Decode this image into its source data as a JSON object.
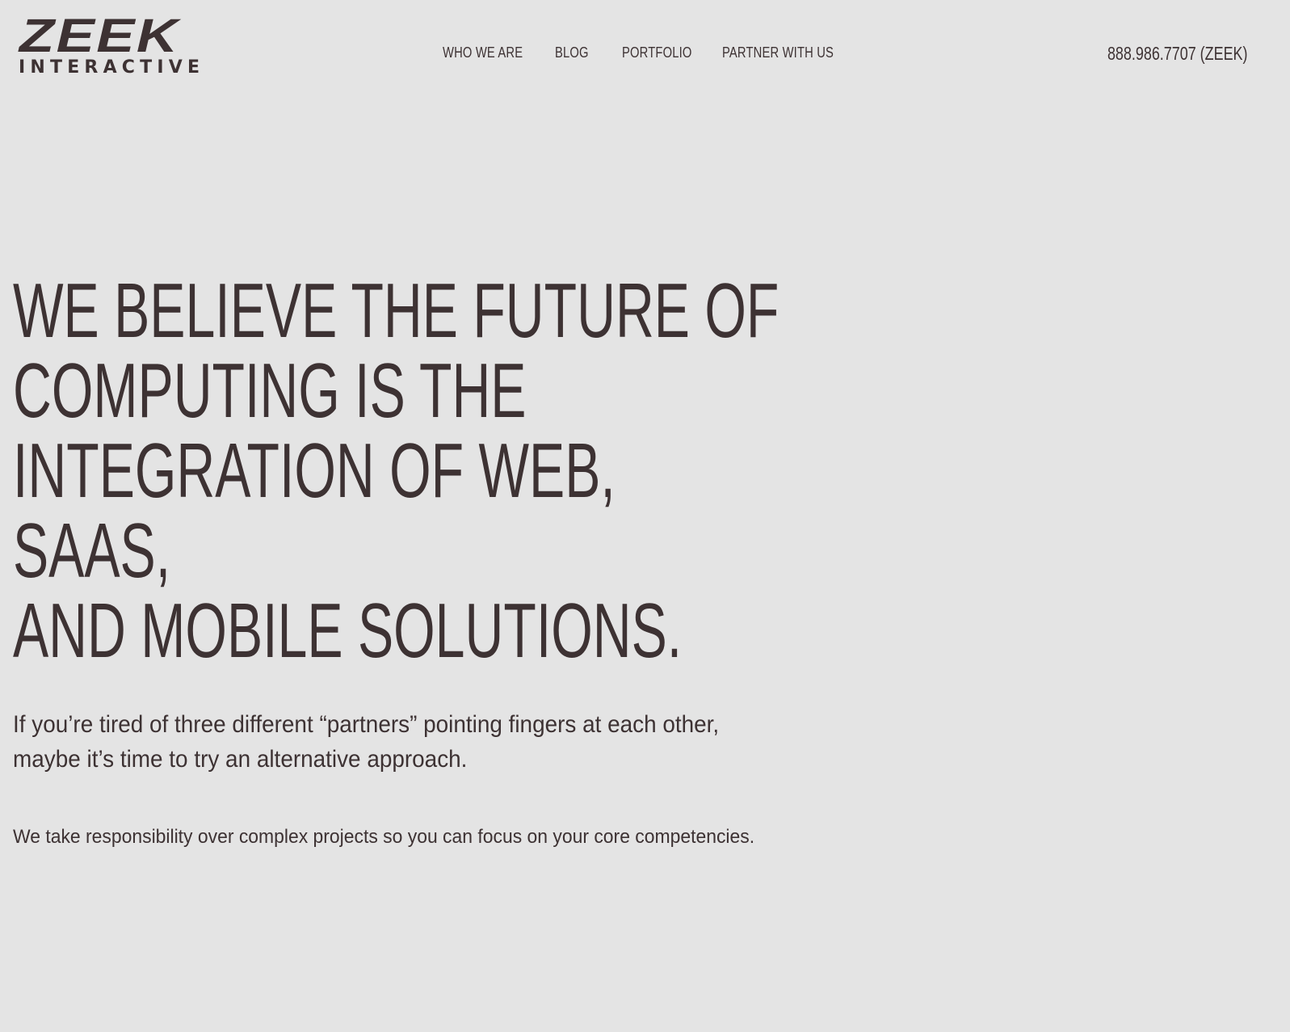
{
  "header": {
    "logo": {
      "word": "ZEEK",
      "sub": "INTERACTIVE"
    },
    "nav": [
      {
        "label": "WHO WE ARE"
      },
      {
        "label": "BLOG"
      },
      {
        "label": "PORTFOLIO"
      },
      {
        "label": "PARTNER WITH US"
      }
    ],
    "phone": "888.986.7707 (ZEEK)"
  },
  "hero": {
    "title_lines": [
      "WE BELIEVE THE FUTURE OF",
      "COMPUTING IS THE",
      "INTEGRATION OF WEB, SAAS,",
      "AND MOBILE SOLUTIONS."
    ],
    "intro_lines": [
      "If you’re tired of three different “partners” pointing fingers at each other,",
      "maybe it’s time to try an alternative approach."
    ],
    "tagline": "We take responsibility over complex projects so you can focus on your core competencies."
  },
  "colors": {
    "background": "#e4e4e4",
    "text": "#3d3233"
  }
}
